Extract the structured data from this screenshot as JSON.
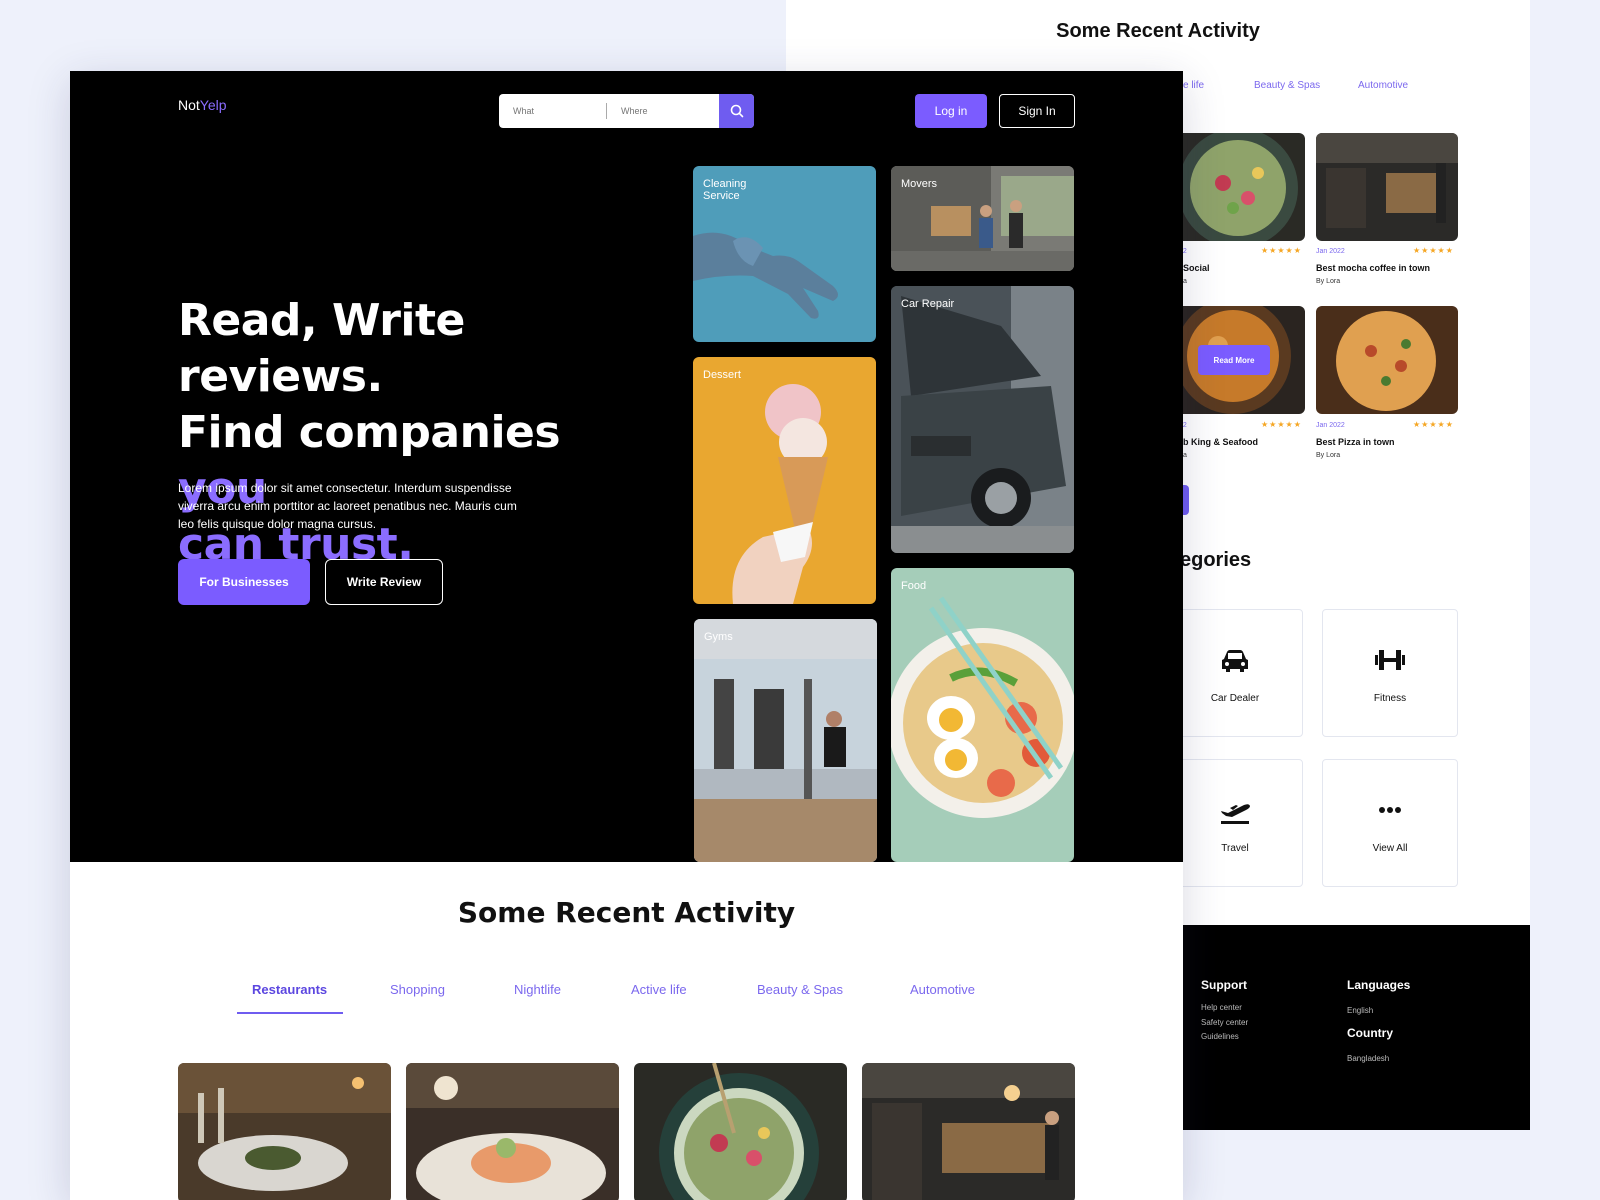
{
  "back_page": {
    "section_title": "Some Recent Activity",
    "tabs": [
      "ve life",
      "Beauty & Spas",
      "Automotive"
    ],
    "cards": [
      {
        "date": "22",
        "stars": "★★★★★",
        "title": "Social",
        "by": "a"
      },
      {
        "date": "Jan 2022",
        "stars": "★★★★★",
        "title": "Best mocha coffee in town",
        "by": "By Lora"
      },
      {
        "date": "22",
        "stars": "★★★★★",
        "title": "b King & Seafood",
        "by": "a"
      },
      {
        "date": "Jan 2022",
        "stars": "★★★★★",
        "title": "Best Pizza in town",
        "by": "By Lora"
      }
    ],
    "read_more": "Read More",
    "categories_title": "egories",
    "categories": [
      {
        "label": "Car Dealer",
        "icon": "car-icon"
      },
      {
        "label": "Fitness",
        "icon": "dumbbell-icon"
      },
      {
        "label": "Travel",
        "icon": "airplane-icon"
      },
      {
        "label": "View All",
        "icon": "more-icon"
      }
    ],
    "footer": {
      "support_title": "Support",
      "support_links": [
        "Help center",
        "Safety center",
        "Guidelines"
      ],
      "languages_title": "Languages",
      "language_value": "English",
      "country_title": "Country",
      "country_value": "Bangladesh"
    }
  },
  "header": {
    "logo_prefix": "Not",
    "logo_accent": "Yelp",
    "search_what_placeholder": "What",
    "search_where_placeholder": "Where",
    "login_label": "Log in",
    "signin_label": "Sign In"
  },
  "hero": {
    "headline_line1": "Read, Write reviews.",
    "headline_line2_white": "Find companies ",
    "headline_line2_purple": "you",
    "headline_line3_purple": "can trust.",
    "description": "Lorem ipsum dolor sit amet consectetur. Interdum suspendisse viverra arcu enim porttitor ac laoreet penatibus nec. Mauris cum leo felis quisque dolor magna cursus.",
    "primary_button": "For Businesses",
    "secondary_button": "Write Review"
  },
  "category_tiles": [
    {
      "label": "Cleaning Service",
      "color": "#4f9dba"
    },
    {
      "label": "Movers",
      "color": "#8a8a85"
    },
    {
      "label": "Car Repair",
      "color": "#5f6a70"
    },
    {
      "label": "Dessert",
      "color": "#e9a730"
    },
    {
      "label": "Gyms",
      "color": "#9aa3ad"
    },
    {
      "label": "Food",
      "color": "#a5cdb9"
    }
  ],
  "recent": {
    "title": "Some Recent Activity",
    "tabs": [
      "Restaurants",
      "Shopping",
      "Nightlife",
      "Active life",
      "Beauty & Spas",
      "Automotive"
    ],
    "active_tab": "Restaurants"
  },
  "colors": {
    "accent": "#7b5cff",
    "hero_bg": "#000000",
    "page_bg": "#eef1fb",
    "star": "#f5a623"
  }
}
